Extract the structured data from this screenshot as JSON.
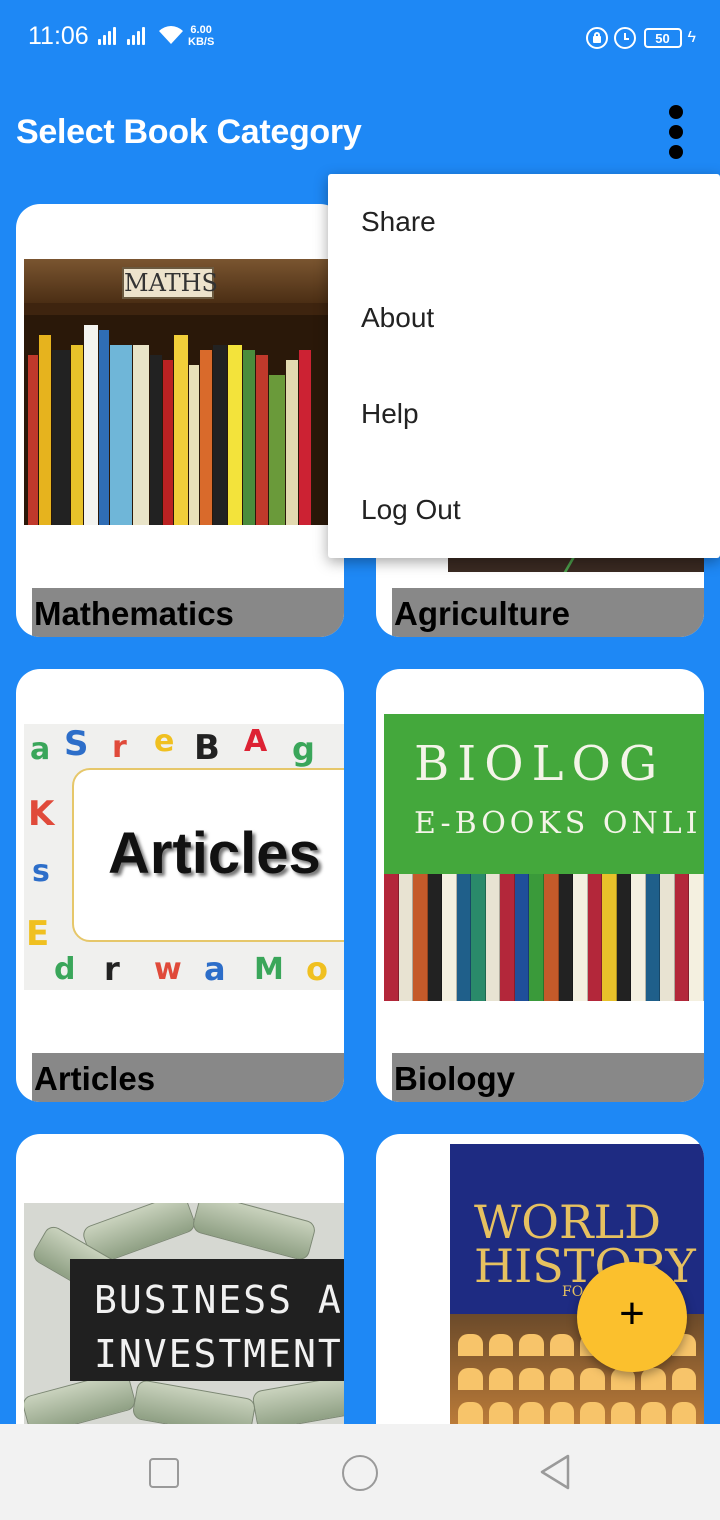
{
  "status_bar": {
    "time": "11:06",
    "net_speed_value": "6.00",
    "net_speed_unit": "KB/S",
    "battery": "50",
    "icons": [
      "signal-icon",
      "signal-icon",
      "wifi-icon",
      "lock-icon",
      "alarm-icon",
      "battery-icon",
      "charging-icon"
    ]
  },
  "app_bar": {
    "title": "Select Book Category",
    "overflow_icon": "more-vert-icon"
  },
  "categories": [
    {
      "label": "Mathematics",
      "image_text": "MATHS"
    },
    {
      "label": "Agriculture"
    },
    {
      "label": "Articles",
      "image_text": "Articles"
    },
    {
      "label": "Biology",
      "image_text_1": "BIOLOG",
      "image_text_2": "E-BOOKS ONLI"
    },
    {
      "image_text_1": "BUSINESS AND",
      "image_text_2": "INVESTMENT"
    },
    {
      "image_text_1": "WORLD",
      "image_text_2": "HISTORY",
      "image_text_3": "FO"
    }
  ],
  "menu": {
    "items": [
      "Share",
      "About",
      "Help",
      "Log Out"
    ]
  },
  "fab": {
    "label": "+"
  },
  "colors": {
    "primary": "#1e88f5",
    "fab": "#fbc02d",
    "label_bg": "#888888"
  }
}
